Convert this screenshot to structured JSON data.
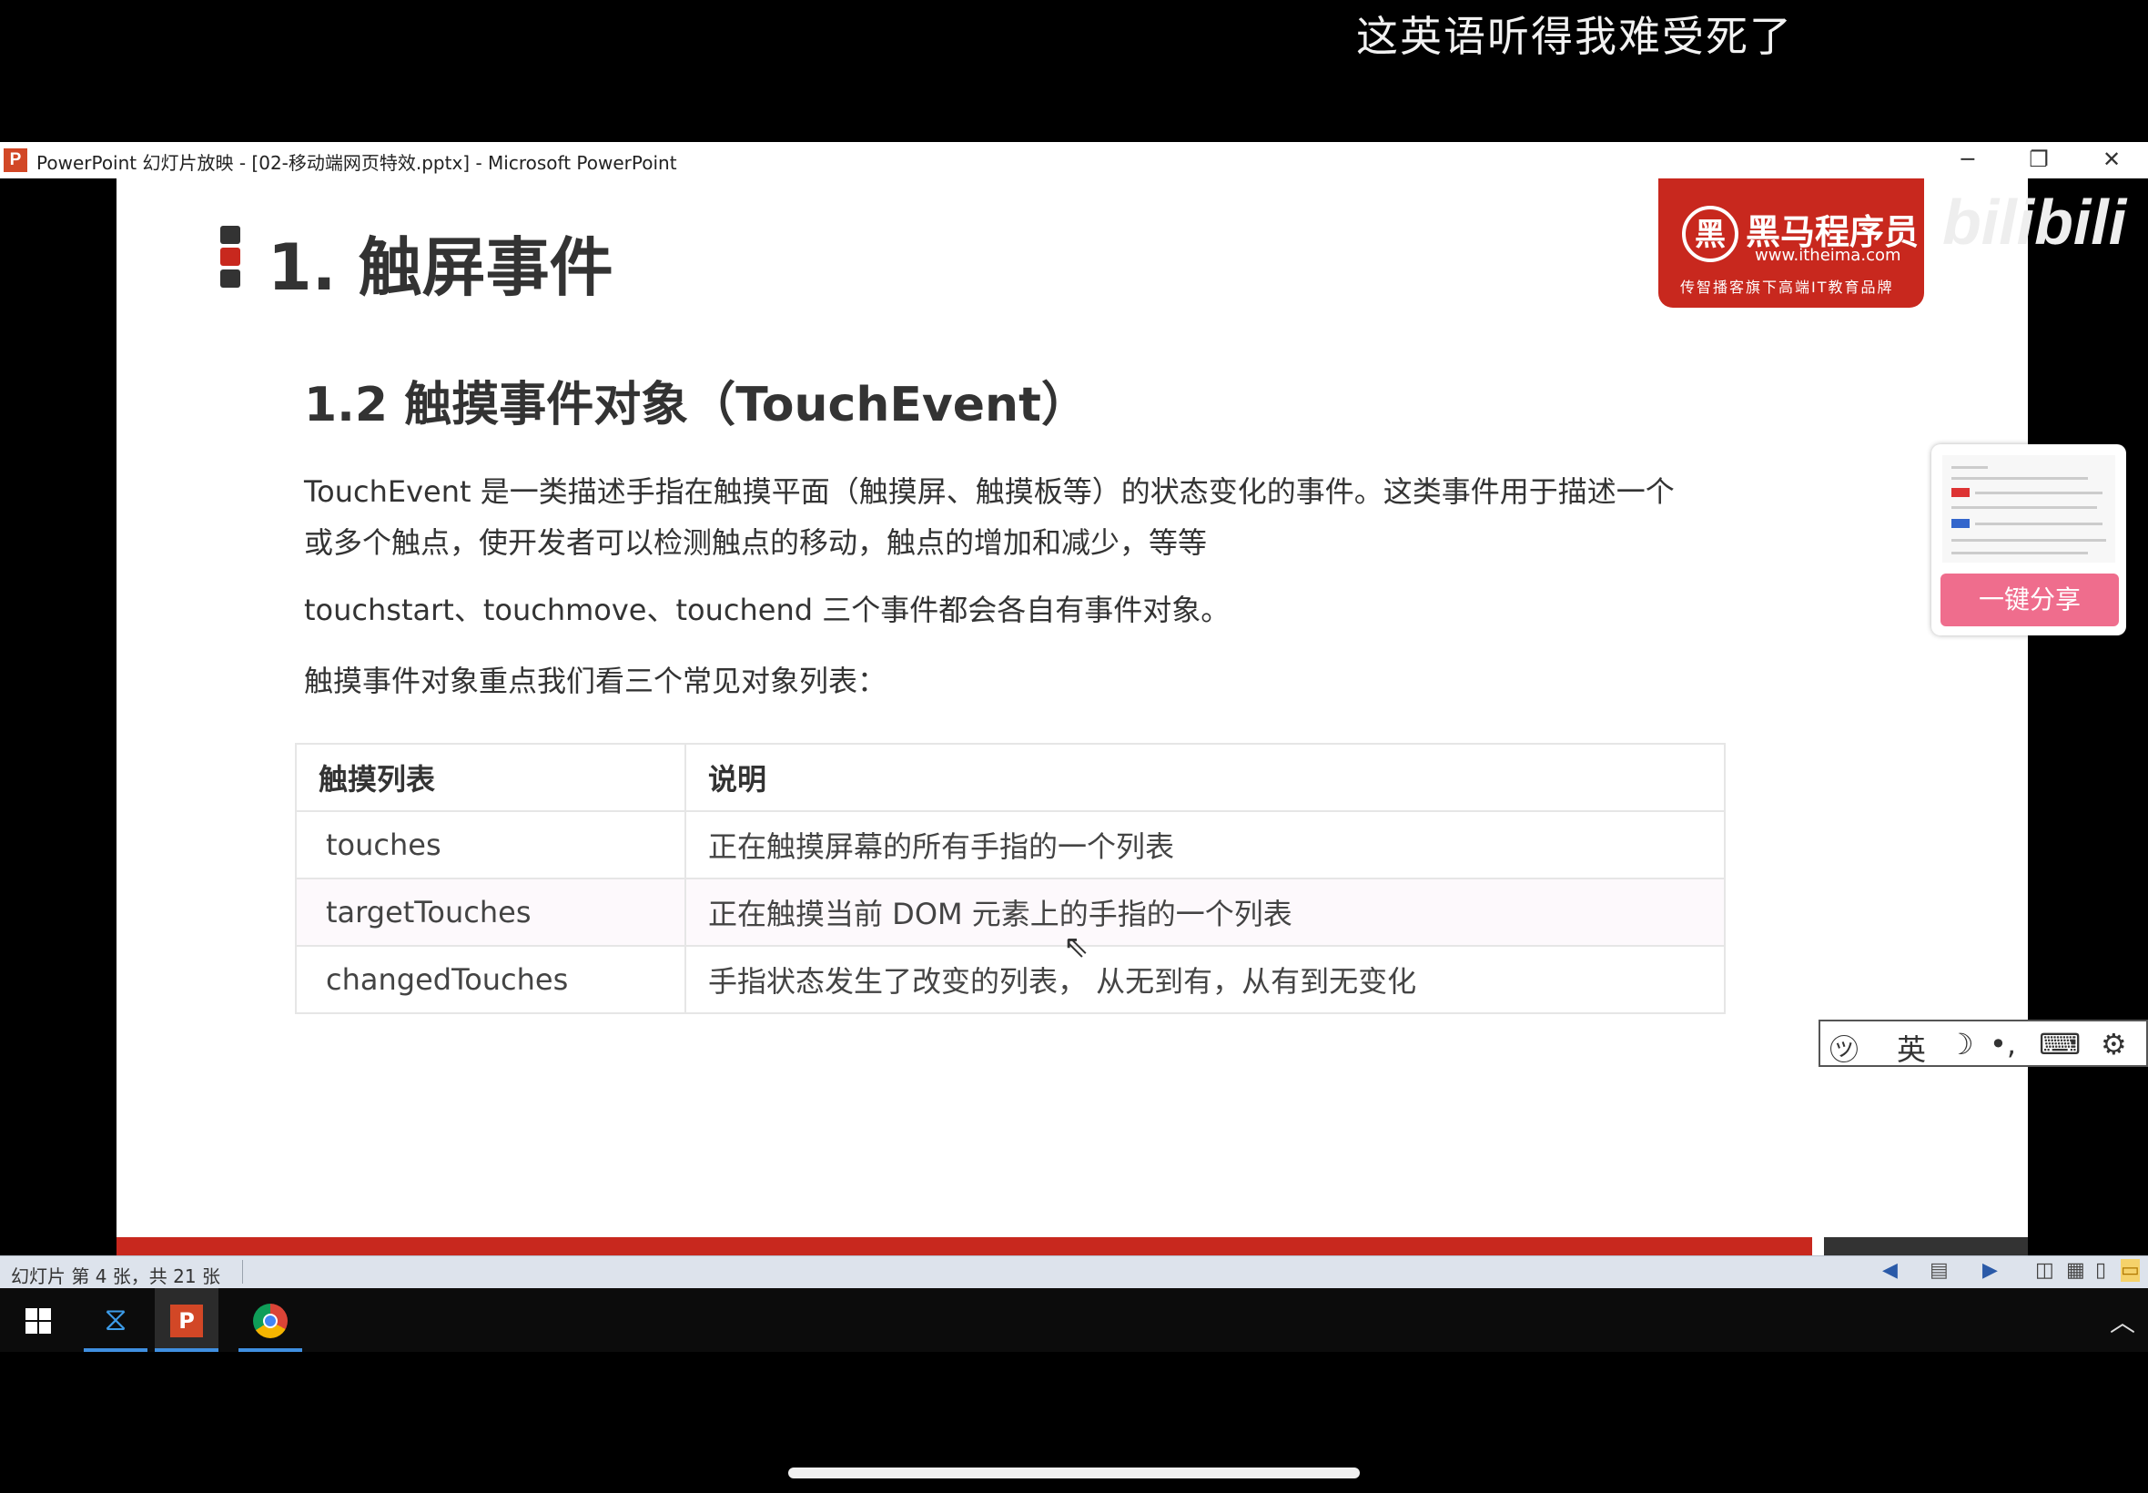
{
  "overlay": {
    "danmaku_comment": "这英语听得我难受死了"
  },
  "window": {
    "title": "PowerPoint 幻灯片放映 - [02-移动端网页特效.pptx] - Microsoft PowerPoint",
    "app_icon_letter": "P",
    "minimize": "─",
    "restore": "❐",
    "close": "✕"
  },
  "slide": {
    "title": "1. 触屏事件",
    "logo": {
      "name": "黑马程序员",
      "url": "www.itheima.com",
      "slogan": "传智播客旗下高端IT教育品牌"
    },
    "watermark": "bilibili",
    "subtitle": "1.2 触摸事件对象（TouchEvent）",
    "paragraph1": "TouchEvent 是一类描述手指在触摸平面（触摸屏、触摸板等）的状态变化的事件。这类事件用于描述一个或多个触点，使开发者可以检测触点的移动，触点的增加和减少，等等",
    "paragraph2": "touchstart、touchmove、touchend 三个事件都会各自有事件对象。",
    "paragraph3": "触摸事件对象重点我们看三个常见对象列表：",
    "table": {
      "headers": [
        "触摸列表",
        "说明"
      ],
      "rows": [
        [
          "touches",
          "正在触摸屏幕的所有手指的一个列表"
        ],
        [
          "targetTouches",
          "正在触摸当前 DOM 元素上的手指的一个列表"
        ],
        [
          "changedTouches",
          "手指状态发生了改变的列表， 从无到有，从有到无变化"
        ]
      ]
    }
  },
  "share_widget": {
    "button_label": "一键分享"
  },
  "ime_toolbar": {
    "mode_label": "英"
  },
  "statusbar": {
    "slide_info": "幻灯片 第 4 张，共 21 张"
  },
  "taskbar": {
    "apps": [
      "vscode-icon",
      "powerpoint-icon",
      "chrome-icon"
    ],
    "active_app": "powerpoint-icon"
  },
  "colors": {
    "brand_red": "#c8281e",
    "share_pink": "#ef6d8d",
    "taskbar_accent": "#3f8fe0"
  }
}
